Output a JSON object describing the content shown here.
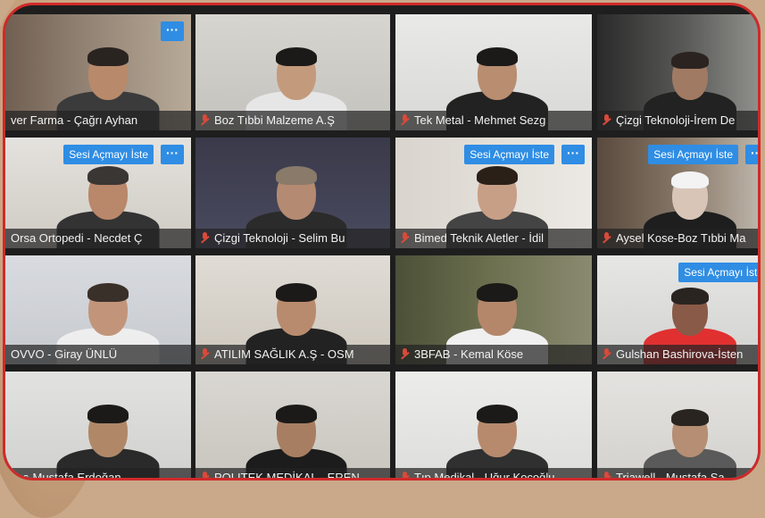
{
  "colors": {
    "accent": "#2f8de4",
    "frame": "#cf2a2a",
    "mic_muted": "#d94a3a"
  },
  "more_button": {
    "label": "···",
    "icon": "more-options-icon"
  },
  "ask_unmute_label": "Sesi Açmayı İste",
  "participants": [
    {
      "name": "ver Farma - Çağrı Ayhan",
      "muted": false,
      "ask": false,
      "more": true
    },
    {
      "name": "Boz Tıbbi Malzeme A.Ş",
      "muted": true,
      "ask": false,
      "more": false
    },
    {
      "name": "Tek Metal - Mehmet Sezg",
      "muted": true,
      "ask": false,
      "more": false
    },
    {
      "name": "Çizgi Teknoloji-İrem De",
      "muted": true,
      "ask": false,
      "more": false
    },
    {
      "name": "Orsa Ortopedi - Necdet Ç",
      "muted": false,
      "ask": true,
      "more": true
    },
    {
      "name": "Çizgi Teknoloji - Selim Bu",
      "muted": true,
      "ask": false,
      "more": false
    },
    {
      "name": "Bimed Teknik Aletler - İdil",
      "muted": true,
      "ask": true,
      "more": true
    },
    {
      "name": "Aysel Kose-Boz Tıbbi Ma",
      "muted": true,
      "ask": true,
      "more": true
    },
    {
      "name": "OVVO - Giray ÜNLÜ",
      "muted": false,
      "ask": false,
      "more": false
    },
    {
      "name": "ATILIM SAĞLIK A.Ş - OSM",
      "muted": true,
      "ask": false,
      "more": false
    },
    {
      "name": "3BFAB - Kemal Köse",
      "muted": true,
      "ask": false,
      "more": false
    },
    {
      "name": "Gulshan Bashirova-İsten",
      "muted": true,
      "ask": true,
      "more": false
    },
    {
      "name": "sos-Mustafa Erdoğan",
      "muted": false,
      "ask": false,
      "more": false
    },
    {
      "name": "POLITEK MEDİKAL - EREN",
      "muted": true,
      "ask": false,
      "more": false
    },
    {
      "name": "Tıp Medikal - Uğur Koçoğlu",
      "muted": true,
      "ask": false,
      "more": false
    },
    {
      "name": "Triawell - Mustafa Sa",
      "muted": true,
      "ask": false,
      "more": false
    }
  ]
}
